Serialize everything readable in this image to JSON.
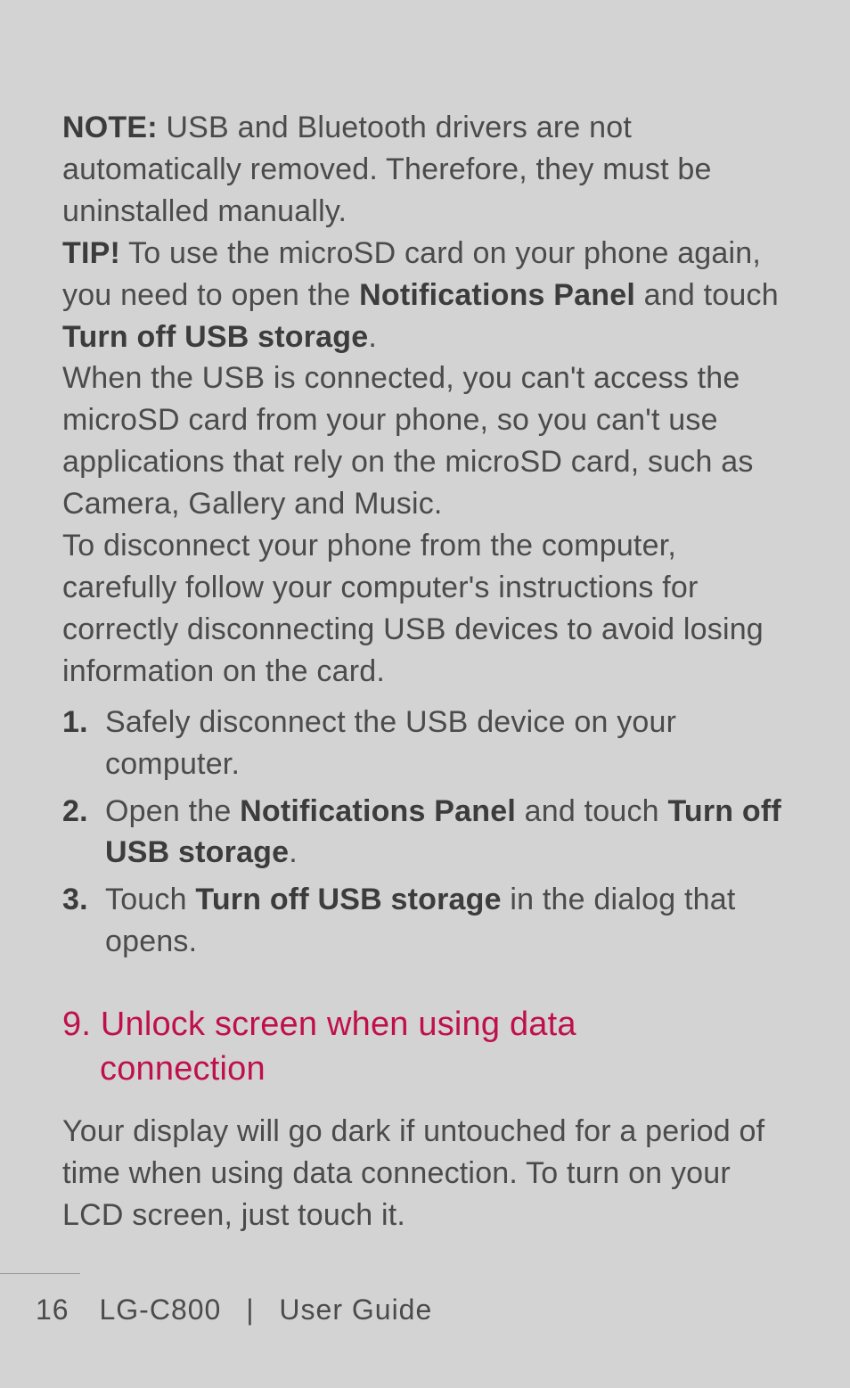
{
  "note": {
    "label": "NOTE:",
    "text": " USB and Bluetooth drivers are not automatically removed. Therefore, they must be uninstalled manually."
  },
  "tip": {
    "label": "TIP!",
    "pre": " To use the microSD card on your phone again, you need to open the ",
    "bold1": "Notifications Panel",
    "mid": " and touch ",
    "bold2": "Turn off USB storage",
    "post": "."
  },
  "usb_connected": "When the USB is connected, you can't access the microSD card from your phone, so you can't use applications that rely on the microSD card, such as Camera, Gallery and Music.",
  "disconnect_intro": "To disconnect your phone from the computer, carefully follow your computer's instructions for correctly disconnecting USB devices to avoid losing information on the card.",
  "steps": {
    "s1": {
      "num": "1.",
      "text": "Safely disconnect the USB device on your computer."
    },
    "s2": {
      "num": "2.",
      "pre": "Open the ",
      "bold1": "Notifications Panel",
      "mid": " and touch ",
      "bold2": "Turn off USB storage",
      "post": "."
    },
    "s3": {
      "num": "3.",
      "pre": "Touch ",
      "bold1": "Turn off USB storage",
      "post": " in the dialog that opens."
    }
  },
  "section9": {
    "line1": "9. Unlock screen when using data",
    "line2": "connection"
  },
  "section9_body": "Your display will go dark if untouched for a period of time when using data connection. To turn on your LCD screen, just touch it.",
  "footer": {
    "page": "16",
    "model": "LG-C800",
    "sep": "|",
    "title": "User Guide"
  }
}
